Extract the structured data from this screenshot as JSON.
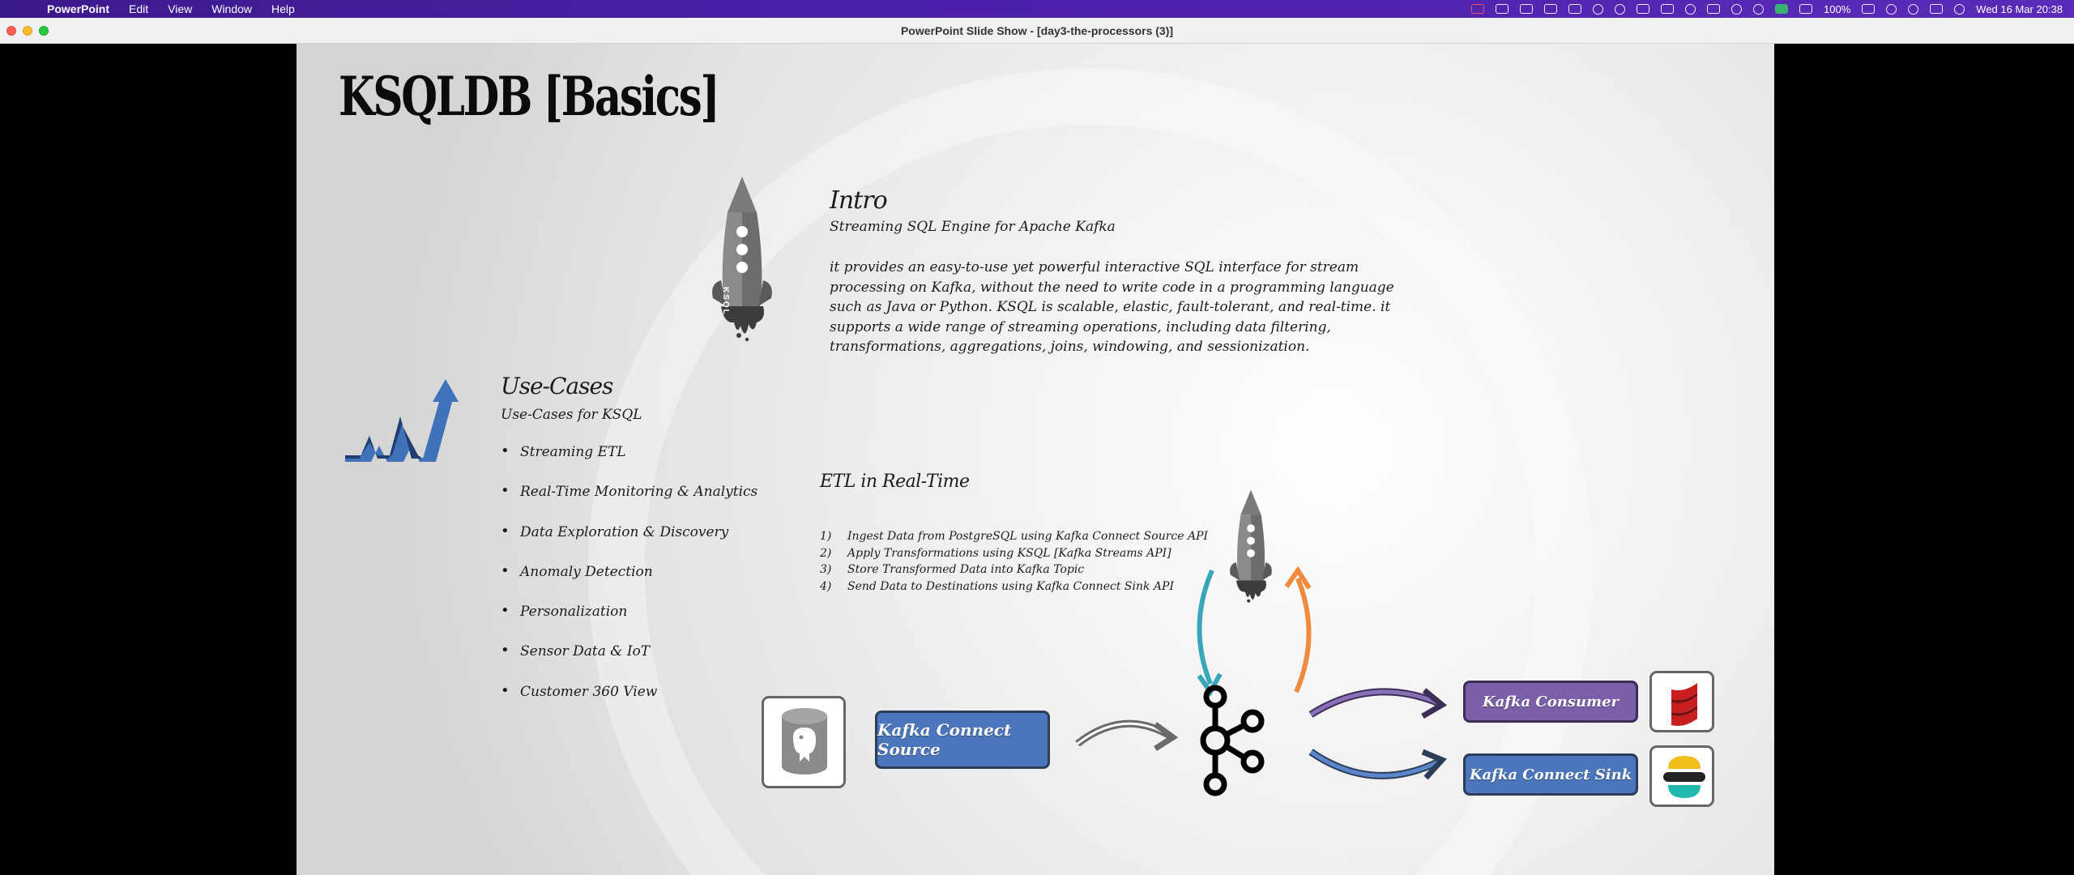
{
  "menubar": {
    "app_name": "PowerPoint",
    "menus": [
      "Edit",
      "View",
      "Window",
      "Help"
    ],
    "battery": "100%",
    "datetime": "Wed 16 Mar  20:38"
  },
  "window": {
    "title": "PowerPoint Slide Show - [day3-the-processors (3)]"
  },
  "slide": {
    "title": "KSQLDB [Basics]",
    "rocket_label": "KSQL",
    "intro": {
      "heading": "Intro",
      "subtitle": "Streaming SQL Engine for Apache Kafka",
      "body": "it provides an easy-to-use yet powerful interactive SQL interface for stream processing on Kafka, without the need to write code in a programming language such as Java or Python. KSQL is scalable, elastic, fault-tolerant, and real-time. it supports a wide range of streaming operations, including data filtering, transformations, aggregations, joins, windowing, and sessionization."
    },
    "use_cases": {
      "heading": "Use-Cases",
      "subtitle": "Use-Cases for KSQL",
      "items": [
        "Streaming ETL",
        "Real-Time Monitoring & Analytics",
        "Data Exploration & Discovery",
        "Anomaly Detection",
        "Personalization",
        "Sensor Data & IoT",
        "Customer 360 View"
      ]
    },
    "etl": {
      "heading": "ETL in Real-Time",
      "steps": [
        {
          "num": "1)",
          "text": "Ingest Data from PostgreSQL using Kafka Connect Source API"
        },
        {
          "num": "2)",
          "text": "Apply Transformations using KSQL [Kafka Streams API]"
        },
        {
          "num": "3)",
          "text": "Store Transformed Data into Kafka Topic"
        },
        {
          "num": "4)",
          "text": "Send Data to Destinations using Kafka Connect Sink API"
        }
      ]
    },
    "diagram": {
      "source_label": "Kafka Connect Source",
      "consumer_label": "Kafka Consumer",
      "sink_label": "Kafka Connect Sink"
    }
  },
  "colors": {
    "menubar": "#4a1fa8",
    "source_box": "#4b76bc",
    "consumer_box": "#7b5fa8",
    "sink_box": "#4b76bc",
    "arrow_teal": "#3aa6b9",
    "arrow_orange": "#f08a3c",
    "arrow_purple": "#7b5fa8",
    "arrow_blue": "#4b76bc"
  }
}
